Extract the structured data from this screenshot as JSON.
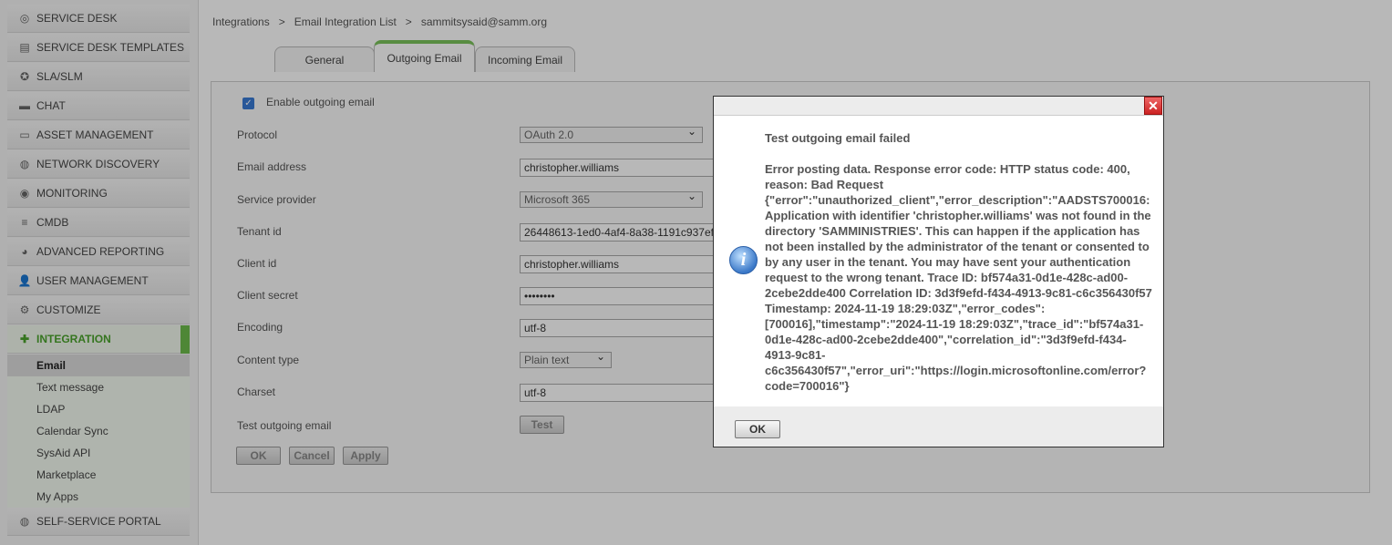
{
  "sidebar": {
    "items": [
      {
        "label": "SERVICE DESK",
        "icon": "lifebuoy-icon"
      },
      {
        "label": "SERVICE DESK TEMPLATES",
        "icon": "template-icon"
      },
      {
        "label": "SLA/SLM",
        "icon": "award-icon"
      },
      {
        "label": "CHAT",
        "icon": "chat-icon"
      },
      {
        "label": "ASSET MANAGEMENT",
        "icon": "monitor-icon"
      },
      {
        "label": "NETWORK DISCOVERY",
        "icon": "globe-icon"
      },
      {
        "label": "MONITORING",
        "icon": "eye-icon"
      },
      {
        "label": "CMDB",
        "icon": "stack-icon"
      },
      {
        "label": "ADVANCED REPORTING",
        "icon": "pie-chart-icon"
      },
      {
        "label": "USER MANAGEMENT",
        "icon": "user-icon"
      },
      {
        "label": "CUSTOMIZE",
        "icon": "gear-icon"
      },
      {
        "label": "INTEGRATION",
        "icon": "puzzle-icon"
      }
    ],
    "sub_items": [
      "Email",
      "Text message",
      "LDAP",
      "Calendar Sync",
      "SysAid API",
      "Marketplace",
      "My Apps"
    ],
    "footer_item": {
      "label": "SELF-SERVICE PORTAL",
      "icon": "globe-icon"
    }
  },
  "breadcrumb": {
    "items": [
      "Integrations",
      "Email Integration List",
      "sammitsysaid@samm.org"
    ],
    "separator": ">"
  },
  "tabs": [
    "General",
    "Outgoing Email",
    "Incoming Email"
  ],
  "form": {
    "enable_label": "Enable outgoing email",
    "protocol_label": "Protocol",
    "protocol_value": "OAuth 2.0",
    "email_label": "Email address",
    "email_value": "christopher.williams",
    "provider_label": "Service provider",
    "provider_value": "Microsoft 365",
    "tenant_label": "Tenant id",
    "tenant_value": "26448613-1ed0-4af4-8a38-1191c937ef3",
    "client_label": "Client id",
    "client_value": "christopher.williams",
    "secret_label": "Client secret",
    "secret_value": "••••••••",
    "encoding_label": "Encoding",
    "encoding_value": "utf-8",
    "content_type_label": "Content type",
    "content_type_value": "Plain text",
    "charset_label": "Charset",
    "charset_value": "utf-8",
    "test_label": "Test outgoing email",
    "test_button": "Test",
    "ok_button": "OK",
    "cancel_button": "Cancel",
    "apply_button": "Apply"
  },
  "dialog": {
    "close_glyph": "✕",
    "info_glyph": "i",
    "title": "Test outgoing email failed",
    "message": "Error posting data. Response error code: HTTP status code: 400, reason: Bad Request {\"error\":\"unauthorized_client\",\"error_description\":\"AADSTS700016: Application with identifier 'christopher.williams' was not found in the directory 'SAMMINISTRIES'. This can happen if the application has not been installed by the administrator of the tenant or consented to by any user in the tenant. You may have sent your authentication request to the wrong tenant. Trace ID: bf574a31-0d1e-428c-ad00-2cebe2dde400 Correlation ID: 3d3f9efd-f434-4913-9c81-c6c356430f57 Timestamp: 2024-11-19 18:29:03Z\",\"error_codes\":[700016],\"timestamp\":\"2024-11-19 18:29:03Z\",\"trace_id\":\"bf574a31-0d1e-428c-ad00-2cebe2dde400\",\"correlation_id\":\"3d3f9efd-f434-4913-9c81-c6c356430f57\",\"error_uri\":\"https://login.microsoftonline.com/error?code=700016\"}",
    "ok_label": "OK"
  },
  "colors": {
    "accent": "#6cbb4c",
    "error_close": "#cc2222",
    "info": "#3a78c8"
  }
}
